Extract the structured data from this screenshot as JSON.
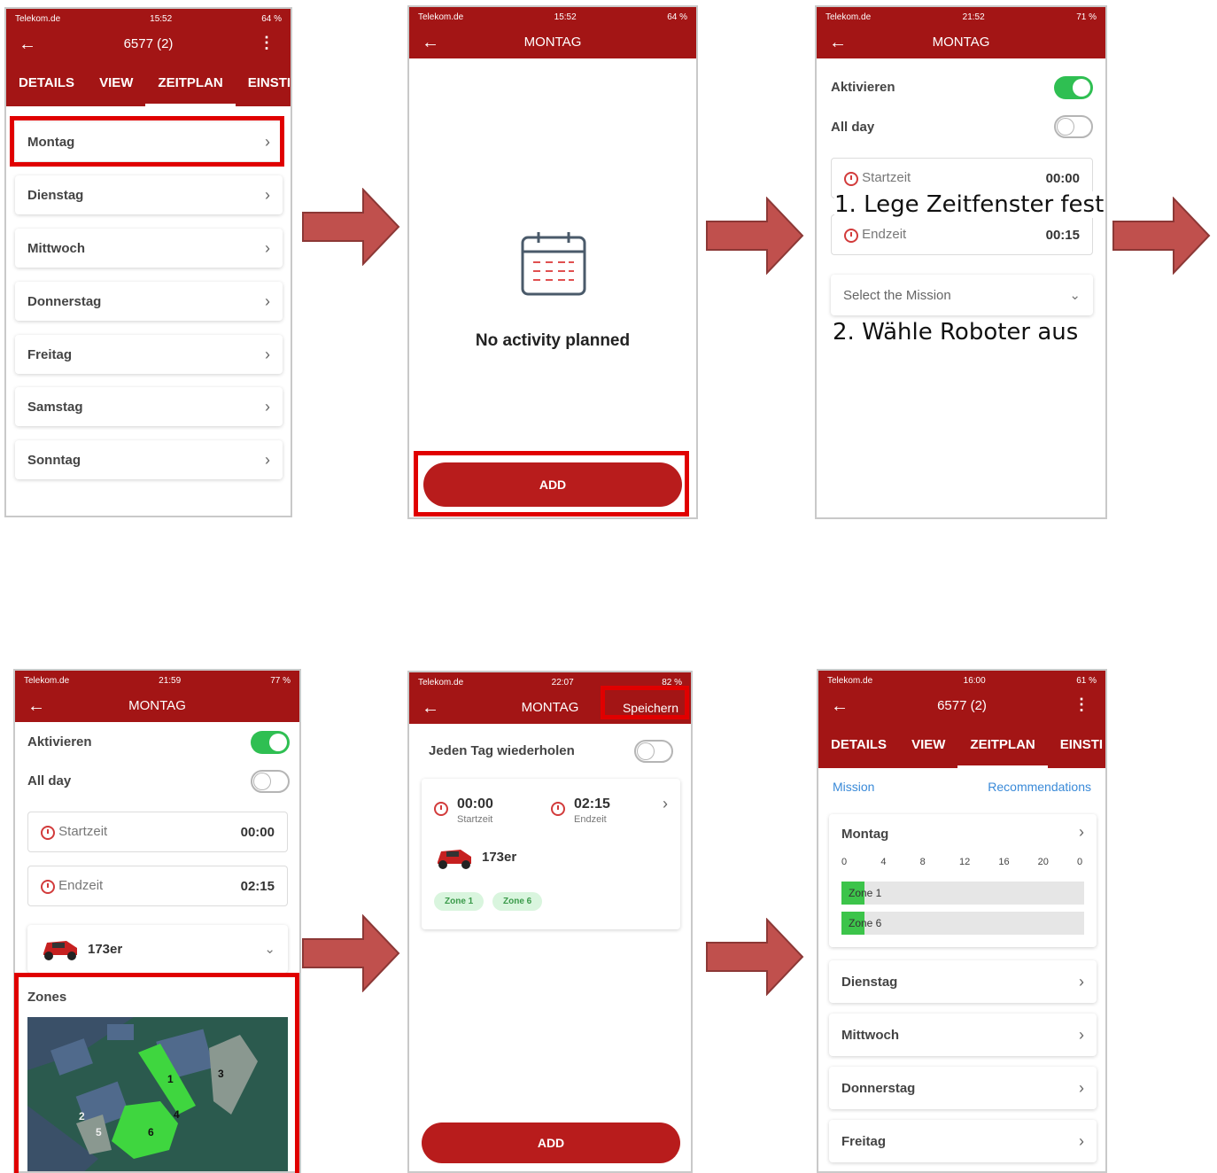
{
  "screens": {
    "s1": {
      "status": {
        "carrier": "Telekom.de",
        "time": "15:52",
        "battery": "64 %"
      },
      "title": "6577 (2)",
      "tabs": [
        "DETAILS",
        "VIEW",
        "ZEITPLAN",
        "EINSTI"
      ],
      "days": [
        "Montag",
        "Dienstag",
        "Mittwoch",
        "Donnerstag",
        "Freitag",
        "Samstag",
        "Sonntag"
      ]
    },
    "s2": {
      "status": {
        "carrier": "Telekom.de",
        "time": "15:52",
        "battery": "64 %"
      },
      "title": "MONTAG",
      "empty_text": "No activity planned",
      "add_label": "ADD"
    },
    "s3": {
      "status": {
        "carrier": "Telekom.de",
        "time": "21:52",
        "battery": "71 %"
      },
      "title": "MONTAG",
      "activate_label": "Aktivieren",
      "allday_label": "All day",
      "start_label": "Startzeit",
      "start_value": "00:00",
      "end_label": "Endzeit",
      "end_value": "00:15",
      "mission_placeholder": "Select the Mission",
      "annotation_1": "1. Lege Zeitfenster fest",
      "annotation_2": "2. Wähle Roboter aus"
    },
    "s4": {
      "status": {
        "carrier": "Telekom.de",
        "time": "21:59",
        "battery": "77 %"
      },
      "title": "MONTAG",
      "activate_label": "Aktivieren",
      "allday_label": "All day",
      "start_label": "Startzeit",
      "start_value": "00:00",
      "end_label": "Endzeit",
      "end_value": "02:15",
      "robot_name": "173er",
      "zones_label": "Zones",
      "map_zone_numbers": [
        "1",
        "2",
        "3",
        "4",
        "5",
        "6"
      ]
    },
    "s5": {
      "status": {
        "carrier": "Telekom.de",
        "time": "22:07",
        "battery": "82 %"
      },
      "title": "MONTAG",
      "save_label": "Speichern",
      "repeat_label": "Jeden Tag wiederholen",
      "start_value": "00:00",
      "start_label": "Startzeit",
      "end_value": "02:15",
      "end_label": "Endzeit",
      "robot_name": "173er",
      "zone_chips": [
        "Zone 1",
        "Zone 6"
      ],
      "add_label": "ADD"
    },
    "s6": {
      "status": {
        "carrier": "Telekom.de",
        "time": "16:00",
        "battery": "61 %"
      },
      "title": "6577 (2)",
      "tabs": [
        "DETAILS",
        "VIEW",
        "ZEITPLAN",
        "EINSTI"
      ],
      "mission_link": "Mission",
      "recommendations_link": "Recommendations",
      "monday_label": "Montag",
      "axis_ticks": [
        "0",
        "4",
        "8",
        "12",
        "16",
        "20",
        "0"
      ],
      "zone_rows": [
        {
          "label": "Zone 1",
          "fraction": 0.094
        },
        {
          "label": "Zone 6",
          "fraction": 0.094
        }
      ],
      "other_days": [
        "Dienstag",
        "Mittwoch",
        "Donnerstag",
        "Freitag"
      ]
    }
  },
  "colors": {
    "brand_red": "#a31515",
    "highlight_red": "#e00000",
    "toggle_green": "#2fbf52",
    "zone_green": "#3cc44a"
  }
}
